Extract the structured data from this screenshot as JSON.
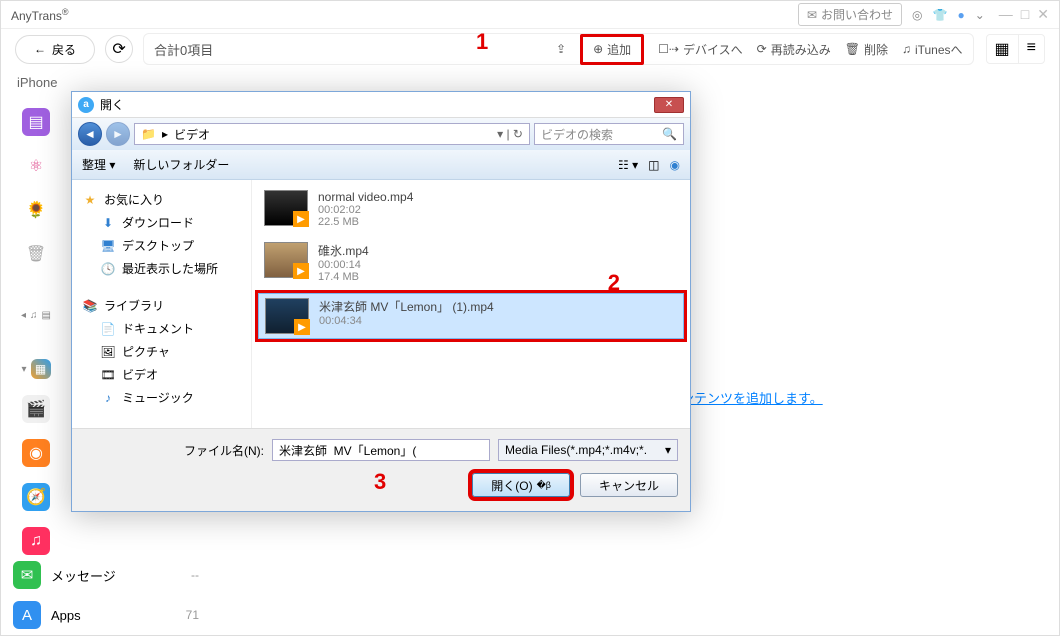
{
  "titlebar": {
    "brand": "AnyTrans",
    "reg": "®",
    "inquiry_label": "お問い合わせ"
  },
  "toolbar": {
    "back_label": "戻る",
    "total_label": "合計0項目",
    "add_label": "追加",
    "to_device_label": "デバイスへ",
    "reload_label": "再読み込み",
    "delete_label": "削除",
    "to_itunes_label": "iTunesへ"
  },
  "crumb": "iPhone",
  "content": {
    "link_text": "ンテンツを追加します。"
  },
  "sidebar": {
    "items": [
      {
        "label": "メッセージ",
        "count": "--"
      },
      {
        "label": "Apps",
        "count": "71"
      }
    ]
  },
  "dialog": {
    "title": "開く",
    "breadcrumb_item": "ビデオ",
    "search_placeholder": "ビデオの検索",
    "organize": "整理",
    "new_folder": "新しいフォルダー",
    "sidebar": {
      "favorites": "お気に入り",
      "downloads": "ダウンロード",
      "desktop": "デスクトップ",
      "recent": "最近表示した場所",
      "library": "ライブラリ",
      "documents": "ドキュメント",
      "pictures": "ピクチャ",
      "videos": "ビデオ",
      "music": "ミュージック"
    },
    "files": [
      {
        "name": "normal video.mp4",
        "duration": "00:02:02",
        "size": "22.5 MB"
      },
      {
        "name": "碓氷.mp4",
        "duration": "00:00:14",
        "size": "17.4 MB"
      },
      {
        "name": "米津玄師  MV「Lemon」 (1).mp4",
        "duration": "00:04:34",
        "size": ""
      }
    ],
    "filename_label": "ファイル名(N):",
    "filename_value": "米津玄師  MV「Lemon」(",
    "type_filter": "Media Files(*.mp4;*.m4v;*.",
    "open_btn": "開く(O)",
    "cancel_btn": "キャンセル"
  },
  "annotations": {
    "a1": "1",
    "a2": "2",
    "a3": "3"
  }
}
